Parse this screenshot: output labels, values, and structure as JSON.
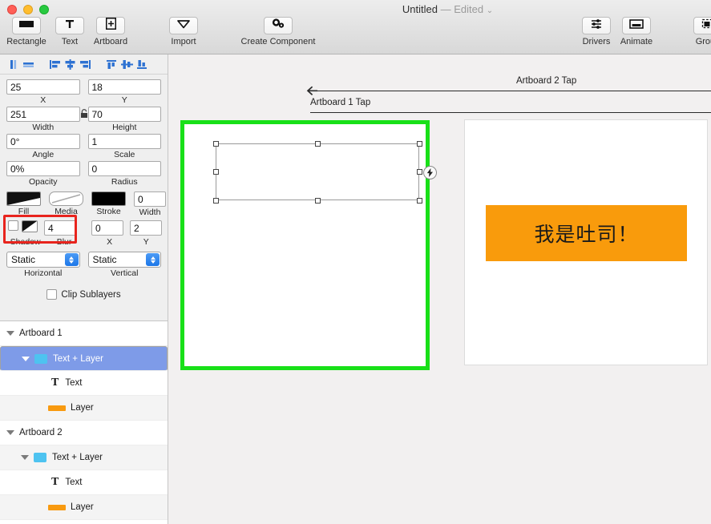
{
  "window": {
    "title_name": "Untitled",
    "title_dash": "—",
    "title_state": "Edited",
    "title_caret": "⌄"
  },
  "toolbar": {
    "items": [
      {
        "label": "Rectangle",
        "icon": "rectangle-icon"
      },
      {
        "label": "Text",
        "icon": "text-icon"
      },
      {
        "label": "Artboard",
        "icon": "artboard-icon"
      },
      {
        "label": "Import",
        "icon": "import-icon"
      },
      {
        "label": "Create Component",
        "icon": "create-component-icon"
      },
      {
        "label": "Drivers",
        "icon": "drivers-icon"
      },
      {
        "label": "Animate",
        "icon": "animate-icon"
      },
      {
        "label": "Group",
        "icon": "group-icon"
      }
    ]
  },
  "align_toolbar": {
    "icons": [
      "align-vertical-center-icon",
      "align-horizontal-center-icon",
      "align-left-icon",
      "align-center-icon",
      "align-right-icon",
      "align-top-icon",
      "align-middle-icon",
      "align-bottom-icon"
    ]
  },
  "inspector": {
    "x": {
      "value": "25",
      "label": "X"
    },
    "y": {
      "value": "18",
      "label": "Y"
    },
    "width": {
      "value": "251",
      "label": "Width"
    },
    "height": {
      "value": "70",
      "label": "Height"
    },
    "angle": {
      "value": "0°",
      "label": "Angle"
    },
    "scale": {
      "value": "1",
      "label": "Scale"
    },
    "opacity": {
      "value": "0%",
      "label": "Opacity"
    },
    "radius": {
      "value": "0",
      "label": "Radius"
    },
    "fill": {
      "label": "Fill",
      "color": "#000000"
    },
    "media": {
      "label": "Media"
    },
    "stroke": {
      "label": "Stroke",
      "color": "#000000"
    },
    "stroke_width": {
      "value": "0",
      "label": "Width"
    },
    "shadow": {
      "label": "Shadow",
      "checked": false
    },
    "blur": {
      "value": "4",
      "label": "Blur"
    },
    "shadow_x": {
      "value": "0",
      "label": "X"
    },
    "shadow_y": {
      "value": "2",
      "label": "Y"
    },
    "horizontal": {
      "value": "Static",
      "label": "Horizontal"
    },
    "vertical": {
      "value": "Static",
      "label": "Vertical"
    },
    "clip_sublayers": {
      "label": "Clip Sublayers",
      "checked": false
    },
    "highlight_color": "#E8241D"
  },
  "layers": [
    {
      "label": "Artboard 1",
      "type": "artboard",
      "indent": 0,
      "selected": false,
      "striped": false
    },
    {
      "label": "Text + Layer",
      "type": "folder",
      "indent": 1,
      "selected": true,
      "striped": false
    },
    {
      "label": "Text",
      "type": "text",
      "indent": 2,
      "selected": false,
      "striped": false
    },
    {
      "label": "Layer",
      "type": "layer",
      "indent": 2,
      "selected": false,
      "striped": true
    },
    {
      "label": "Artboard 2",
      "type": "artboard",
      "indent": 0,
      "selected": false,
      "striped": false
    },
    {
      "label": "Text + Layer",
      "type": "folder",
      "indent": 1,
      "selected": false,
      "striped": true
    },
    {
      "label": "Text",
      "type": "text",
      "indent": 2,
      "selected": false,
      "striped": false
    },
    {
      "label": "Layer",
      "type": "layer",
      "indent": 2,
      "selected": false,
      "striped": true
    }
  ],
  "canvas": {
    "connections": [
      {
        "label": "Artboard 2 Tap",
        "direction": "left"
      },
      {
        "label": "Artboard 1 Tap",
        "direction": "right"
      }
    ],
    "artboard_1": {
      "selected": true,
      "selection_border_color": "#18E018",
      "badge_icon": "lightning-bolt-icon"
    },
    "artboard_2": {
      "selected": false,
      "toast_text": "我是吐司！",
      "toast_color": "#F99B0C"
    }
  }
}
